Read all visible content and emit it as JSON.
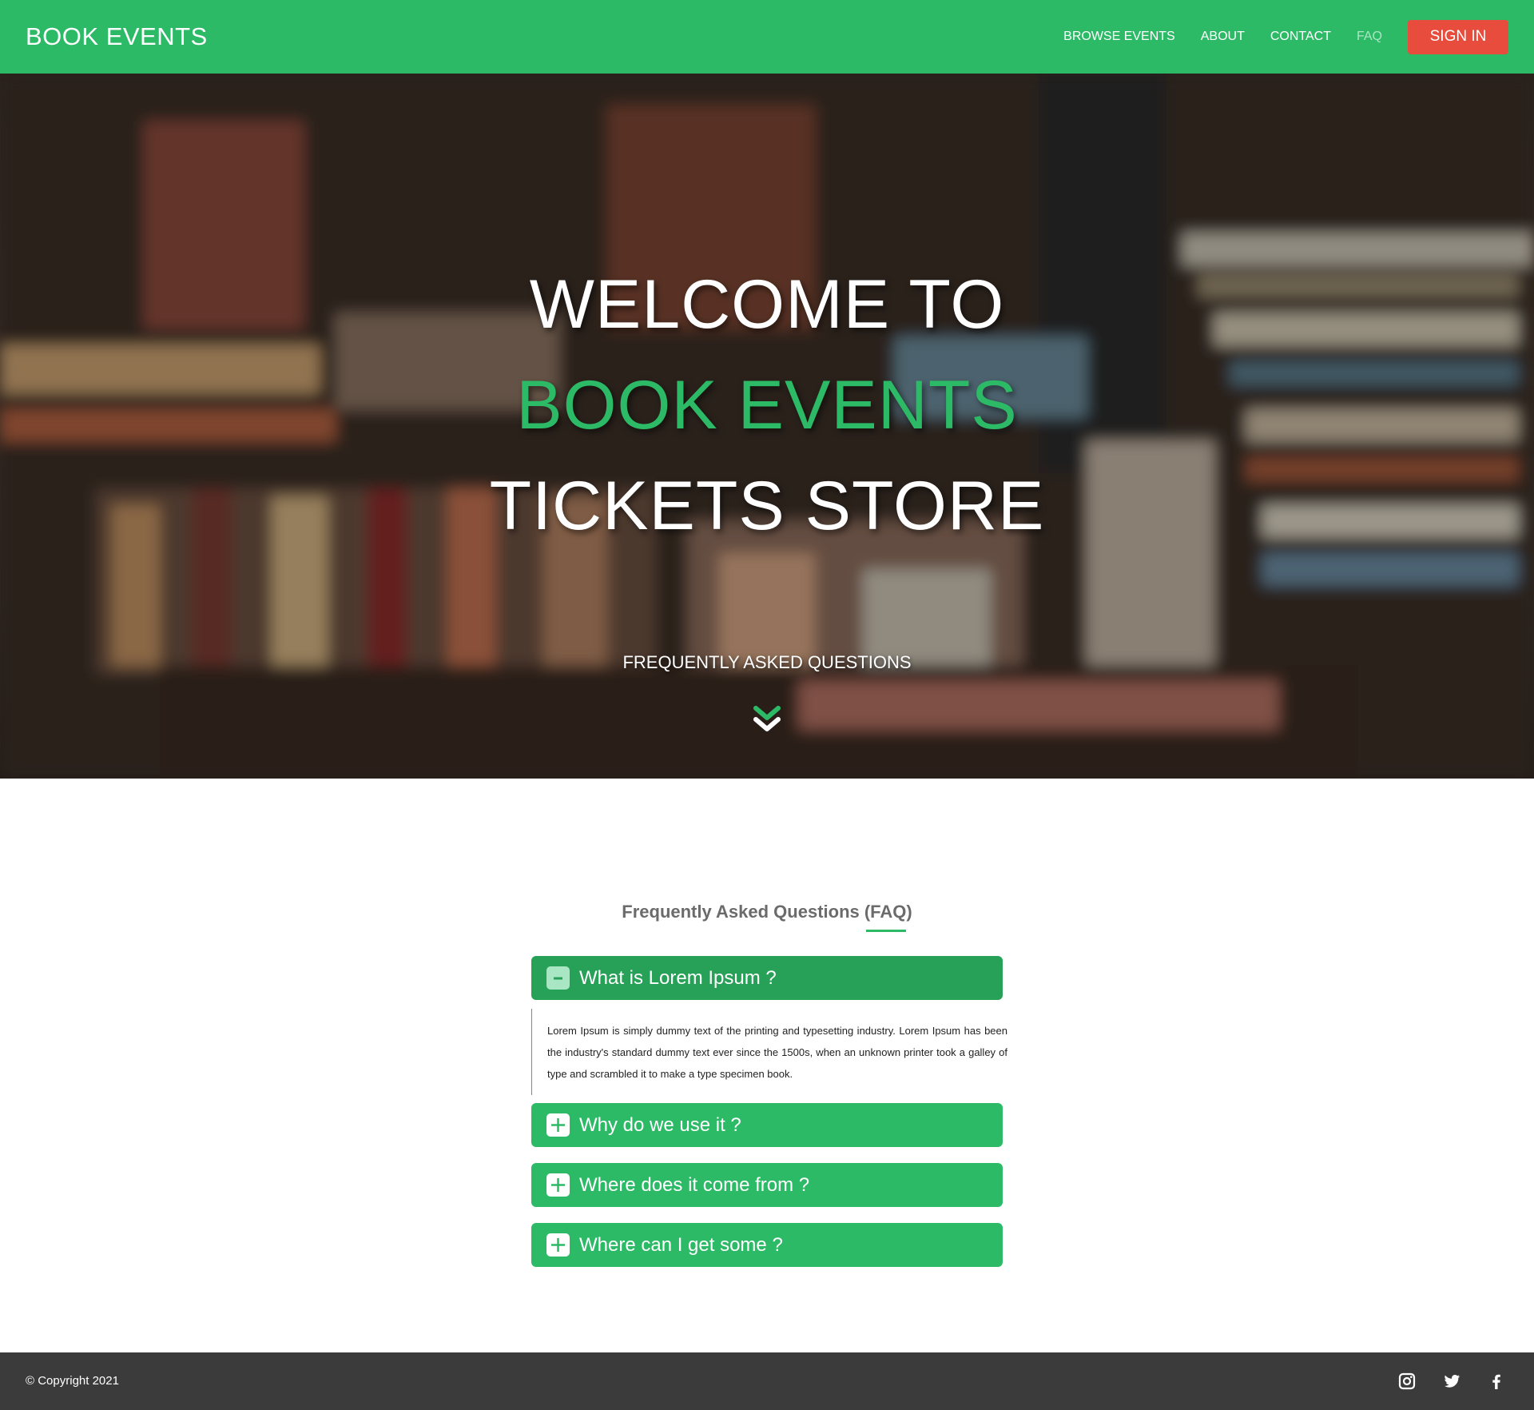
{
  "navbar": {
    "brand": "BOOK EVENTS",
    "links": [
      "BROWSE EVENTS",
      "ABOUT",
      "CONTACT",
      "FAQ"
    ],
    "active_link": "FAQ",
    "signin_label": "SIGN IN"
  },
  "hero": {
    "line1": "WELCOME TO",
    "line2": "BOOK EVENTS",
    "line3": "TICKETS STORE",
    "subtitle": "FREQUENTLY ASKED QUESTIONS",
    "scroll_icon": "chevron-down-icon"
  },
  "faq": {
    "heading": "Frequently Asked Questions (FAQ)",
    "items": [
      {
        "question": "What is Lorem Ipsum ?",
        "state": "expanded",
        "answer": "Lorem Ipsum is simply dummy text of the printing and typesetting industry. Lorem Ipsum has been the industry's standard dummy text ever since the 1500s, when an unknown printer took a galley of type and scrambled it to make a type specimen book."
      },
      {
        "question": "Why do we use it ?",
        "state": "collapsed"
      },
      {
        "question": "Where does it come from ?",
        "state": "collapsed"
      },
      {
        "question": "Where can I get some ?",
        "state": "collapsed"
      }
    ]
  },
  "footer": {
    "copyright": "© Copyright 2021",
    "social_icons": [
      "instagram-icon",
      "twitter-icon",
      "facebook-icon"
    ]
  },
  "colors": {
    "brand_green": "#2dba67",
    "dark_green": "#27a058",
    "signin_red": "#e74c3c",
    "footer_bg": "#3c3b3b"
  }
}
